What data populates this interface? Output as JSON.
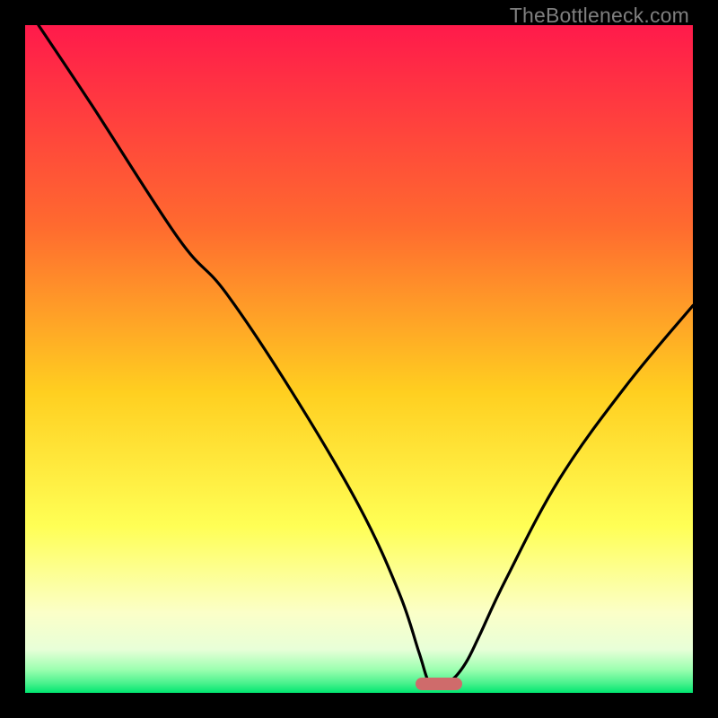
{
  "watermark": {
    "text": "TheBottleneck.com"
  },
  "colors": {
    "top": "#ff1a4b",
    "orange": "#ff8a2a",
    "yellow": "#ffe430",
    "pale": "#f9ffb8",
    "green_light": "#9cffb0",
    "green": "#00e670",
    "curve": "#000000",
    "marker": "#cf6b6b",
    "frame": "#000000"
  },
  "chart_data": {
    "type": "line",
    "title": "",
    "xlabel": "",
    "ylabel": "",
    "xlim": [
      0,
      100
    ],
    "ylim": [
      0,
      100
    ],
    "curve": {
      "x": [
        2,
        10,
        23,
        30,
        40,
        50,
        56,
        59,
        60.5,
        62,
        64,
        66,
        68,
        72,
        80,
        90,
        100
      ],
      "y": [
        100,
        88,
        68,
        60,
        45,
        28,
        15,
        6,
        1.5,
        1,
        2,
        4.5,
        8.5,
        17,
        32,
        46,
        58
      ]
    },
    "marker": {
      "x_start": 58.5,
      "x_end": 65.5,
      "y": 1.3
    },
    "gradient_stops": [
      {
        "offset": 0,
        "color": "#ff1a4b"
      },
      {
        "offset": 0.3,
        "color": "#ff6a2f"
      },
      {
        "offset": 0.55,
        "color": "#ffcf20"
      },
      {
        "offset": 0.75,
        "color": "#ffff55"
      },
      {
        "offset": 0.88,
        "color": "#fbffc8"
      },
      {
        "offset": 0.935,
        "color": "#e8ffd8"
      },
      {
        "offset": 0.965,
        "color": "#9cffb0"
      },
      {
        "offset": 0.985,
        "color": "#4cf28e"
      },
      {
        "offset": 1.0,
        "color": "#00e670"
      }
    ]
  }
}
